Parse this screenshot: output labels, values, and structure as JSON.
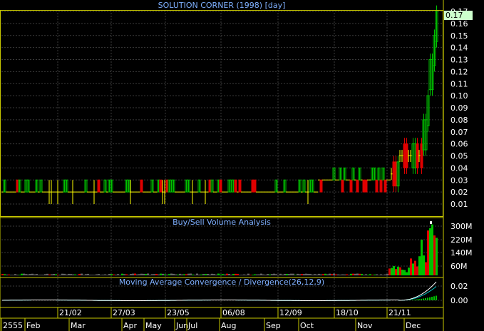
{
  "window": {
    "title": "SOLUTION CORNER (1998) [day]"
  },
  "price_panel": {
    "title": "SOLUTION CORNER (1998) [day]",
    "last_price_label": "0.17",
    "y_ticks": [
      "0.17",
      "0.16",
      "0.15",
      "0.14",
      "0.13",
      "0.12",
      "0.11",
      "0.10",
      "0.09",
      "0.08",
      "0.07",
      "0.06",
      "0.05",
      "0.04",
      "0.03",
      "0.02",
      "0.01"
    ]
  },
  "volume_panel": {
    "title": "Buy/Sell Volume Analysis",
    "y_ticks": [
      "300M",
      "220M",
      "140M",
      "60M"
    ]
  },
  "macd_panel": {
    "title": "Moving Average Convergence / Divergence(26,12,9)",
    "y_ticks": [
      "0.02",
      "0.00"
    ]
  },
  "x_axis": {
    "date_labels": [
      "21/02",
      "27/03",
      "23/05",
      "06/08",
      "12/09",
      "18/10",
      "21/11"
    ],
    "month_labels": [
      "2555",
      "Feb",
      "Mar",
      "Apr",
      "May",
      "Jun",
      "Jul",
      "Aug",
      "Sep",
      "Oct",
      "Nov",
      "Dec"
    ]
  },
  "colors": {
    "background": "#000000",
    "grid": "#3a3a3a",
    "axis_text": "#ffffff",
    "title_text": "#7fb0ff",
    "up": "#00c000",
    "down": "#e00000",
    "doji": "#ffff00",
    "panel_border": "#c8c800",
    "last_price_bg": "#ccffcc",
    "macd_line": "#ffffff",
    "macd_signal": "#00c0c0",
    "macd_hist": "#00c000"
  },
  "chart_data": [
    {
      "type": "candlestick",
      "title": "SOLUTION CORNER (1998) [day]",
      "ylim": [
        0.0,
        0.17
      ],
      "x_range": [
        "2555-01",
        "2555-12"
      ],
      "series": [
        {
          "name": "price",
          "segments": [
            {
              "period": "Jan-Sep",
              "level": 0.02,
              "high": 0.04,
              "low": 0.01
            },
            {
              "period": "Oct-Nov",
              "level": 0.03,
              "high": 0.04,
              "low": 0.02
            },
            {
              "period": "late Nov",
              "level": 0.05,
              "high": 0.06,
              "low": 0.04
            },
            {
              "period": "Dec",
              "level": 0.17,
              "high": 0.17,
              "low": 0.05
            }
          ]
        }
      ],
      "last": 0.17
    },
    {
      "type": "bar",
      "title": "Buy/Sell Volume Analysis",
      "ylim": [
        0,
        340
      ],
      "unit": "M",
      "notes": "Volume near baseline Jan-Nov; spikes in late Nov and Dec up to ~330M"
    },
    {
      "type": "line",
      "title": "Moving Average Convergence / Divergence(26,12,9)",
      "ylim": [
        -0.01,
        0.03
      ],
      "notes": "Flat near 0.00 until Dec, then rises to ~0.03"
    }
  ]
}
